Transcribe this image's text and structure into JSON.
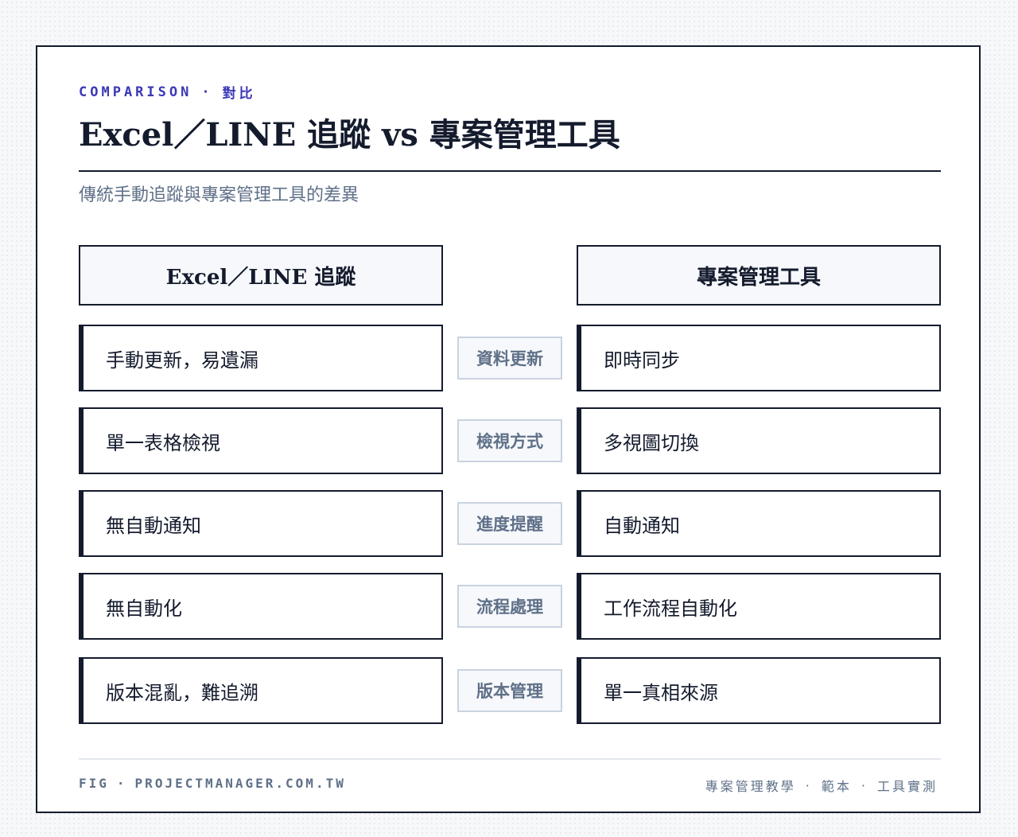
{
  "header": {
    "eyebrow_en": "COMPARISON",
    "eyebrow_sep": "·",
    "eyebrow_zh": "對比",
    "title": "Excel／LINE 追蹤 vs 專案管理工具",
    "subtitle": "傳統手動追蹤與專案管理工具的差異"
  },
  "columns": {
    "left_title": "Excel／LINE 追蹤",
    "right_title": "專案管理工具"
  },
  "rows": [
    {
      "category": "資料更新",
      "left": "手動更新，易遺漏",
      "right": "即時同步"
    },
    {
      "category": "檢視方式",
      "left": "單一表格檢視",
      "right": "多視圖切換"
    },
    {
      "category": "進度提醒",
      "left": "無自動通知",
      "right": "自動通知"
    },
    {
      "category": "流程處理",
      "left": "無自動化",
      "right": "工作流程自動化"
    },
    {
      "category": "版本管理",
      "left": "版本混亂，難追溯",
      "right": "單一真相來源"
    }
  ],
  "footer": {
    "left_prefix": "FIG",
    "left_sep": "·",
    "left_site": "PROJECTMANAGER.COM.TW",
    "right_items": [
      "專案管理教學",
      "範本",
      "工具實測"
    ],
    "right_sep": "·"
  },
  "colors": {
    "ink": "#141b2d",
    "accent": "#3b37b8",
    "muted": "#5f7088",
    "tag_border": "#c9d3e0",
    "head_bg": "#f6f8fb"
  }
}
